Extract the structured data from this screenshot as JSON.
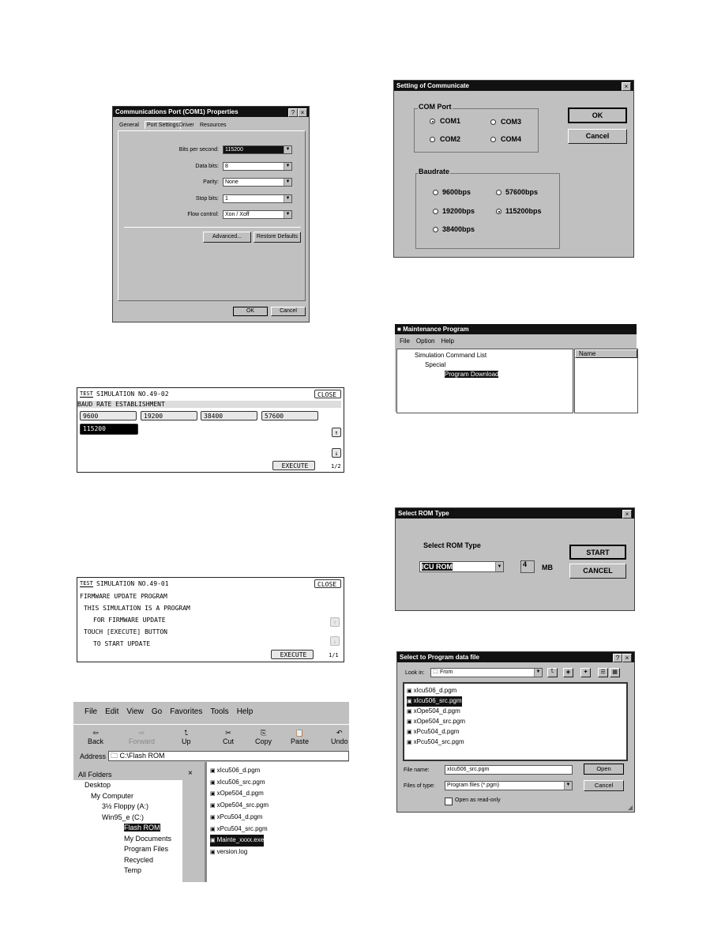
{
  "com_props": {
    "title": "Communications Port (COM1) Properties",
    "tabs": [
      "General",
      "Port Settings",
      "Driver",
      "Resources"
    ],
    "active_tab": "Port Settings",
    "fields": [
      {
        "label": "Bits per second:",
        "value": "115200"
      },
      {
        "label": "Data bits:",
        "value": "8"
      },
      {
        "label": "Parity:",
        "value": "None"
      },
      {
        "label": "Stop bits:",
        "value": "1"
      },
      {
        "label": "Flow control:",
        "value": "Xon / Xoff"
      }
    ],
    "advanced": "Advanced...",
    "restore": "Restore Defaults",
    "ok": "OK",
    "cancel": "Cancel"
  },
  "sim4902": {
    "icon": "TEST",
    "title": "SIMULATION NO.49-02",
    "close": "CLOSE",
    "heading": "BAUD RATE ESTABLISHMENT",
    "rates": [
      "9600",
      "19200",
      "38400",
      "57600",
      "115200"
    ],
    "selected": "115200",
    "execute": "EXECUTE",
    "page": "1/2"
  },
  "sim4901": {
    "icon": "TEST",
    "title": "SIMULATION NO.49-01",
    "close": "CLOSE",
    "lines": [
      "FIRMWARE UPDATE PROGRAM",
      "THIS SIMULATION IS A PROGRAM",
      "FOR FIRMWARE UPDATE",
      "TOUCH [EXECUTE] BUTTON",
      "TO START UPDATE"
    ],
    "execute": "EXECUTE",
    "page": "1/1"
  },
  "explorer": {
    "menu": [
      "File",
      "Edit",
      "View",
      "Go",
      "Favorites",
      "Tools",
      "Help"
    ],
    "toolbar": [
      "Back",
      "Forward",
      "Up",
      "Cut",
      "Copy",
      "Paste",
      "Undo"
    ],
    "address_label": "Address",
    "address": "C:\\Flash ROM",
    "all_folders": "All Folders",
    "tree": [
      "Desktop",
      "My Computer",
      "3½ Floppy (A:)",
      "Win95_e (C:)",
      "Flash ROM",
      "My Documents",
      "Program Files",
      "Recycled",
      "Temp"
    ],
    "files": [
      "xIcu506_d.pgm",
      "xIcu506_src.pgm",
      "xOpe504_d.pgm",
      "xOpe504_src.pgm",
      "xPcu504_d.pgm",
      "xPcu504_src.pgm",
      "Mainte_xxxx.exe",
      "version.log"
    ],
    "selected_file": "Mainte_xxxx.exe"
  },
  "setcomm": {
    "title": "Setting of Communicate",
    "com_group": "COM Port",
    "com": [
      "COM1",
      "COM3",
      "COM2",
      "COM4"
    ],
    "com_selected": "COM1",
    "baud_group": "Baudrate",
    "bauds": [
      "9600bps",
      "57600bps",
      "19200bps",
      "115200bps",
      "38400bps"
    ],
    "baud_selected": "115200bps",
    "ok": "OK",
    "cancel": "Cancel"
  },
  "mainte": {
    "title": "Maintenance Program",
    "menu": [
      "File",
      "Option",
      "Help"
    ],
    "tree": [
      "Simulation Command List",
      "Special",
      "Program Download"
    ],
    "column": "Name"
  },
  "romtype": {
    "title": "Select ROM Type",
    "label": "Select ROM Type",
    "value": "ICU ROM",
    "size": "4",
    "unit": "MB",
    "start": "START",
    "cancel": "CANCEL"
  },
  "openfile": {
    "title": "Select to Program data file",
    "lookin_label": "Look in:",
    "lookin": "From",
    "files": [
      "xIcu506_d.pgm",
      "xIcu506_src.pgm",
      "xOpe504_d.pgm",
      "xOpe504_src.pgm",
      "xPcu504_d.pgm",
      "xPcu504_src.pgm"
    ],
    "filename_label": "File name:",
    "filename": "xIcu506_src.pgm",
    "type_label": "Files of type:",
    "type": "Program files (*.pgm)",
    "readonly": "Open as read-only",
    "open": "Open",
    "cancel": "Cancel"
  }
}
